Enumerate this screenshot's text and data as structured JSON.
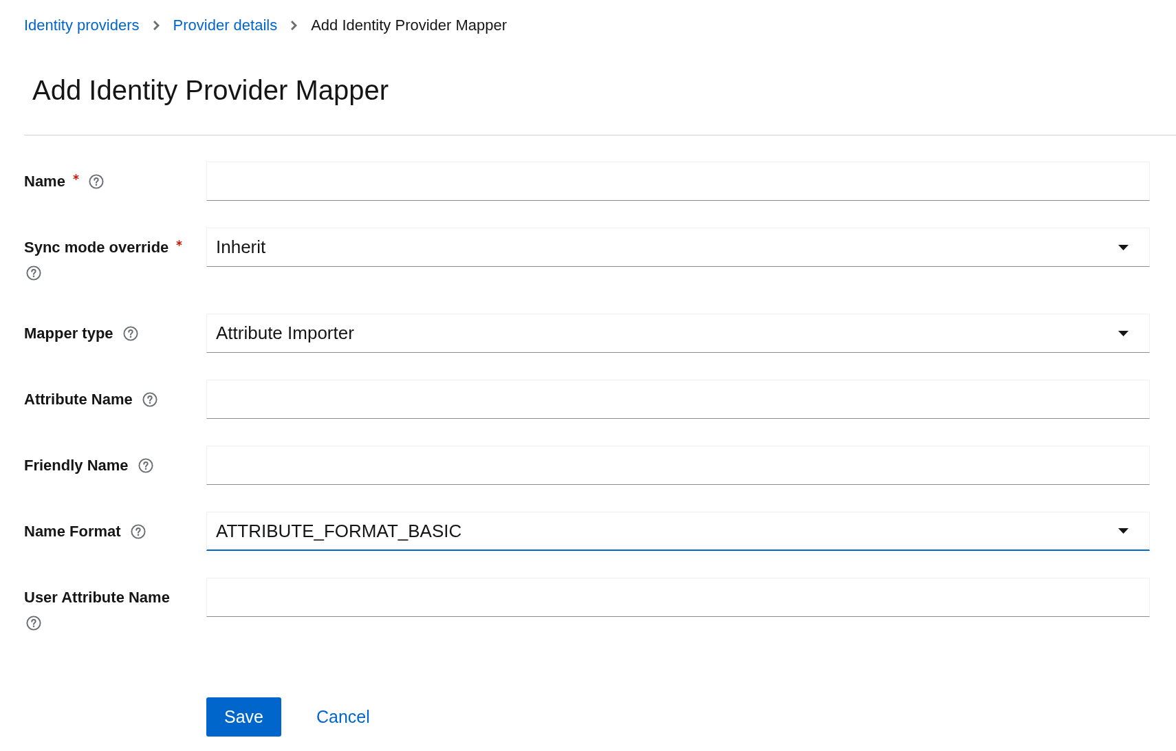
{
  "breadcrumb": [
    {
      "label": "Identity providers",
      "kind": "link"
    },
    {
      "label": "Provider details",
      "kind": "link"
    },
    {
      "label": "Add Identity Provider Mapper",
      "kind": "current"
    }
  ],
  "page": {
    "title": "Add Identity Provider Mapper"
  },
  "form": {
    "fields": [
      {
        "label": "Name",
        "required": true,
        "kind": "text",
        "focused": false
      },
      {
        "label": "Sync mode override",
        "required": true,
        "kind": "select",
        "value": "Inherit",
        "focused": false
      },
      {
        "label": "Mapper type",
        "required": false,
        "kind": "select",
        "value": "Attribute Importer",
        "focused": false
      },
      {
        "label": "Attribute Name",
        "required": false,
        "kind": "text",
        "focused": false
      },
      {
        "label": "Friendly Name",
        "required": false,
        "kind": "text",
        "focused": false
      },
      {
        "label": "Name Format",
        "required": false,
        "kind": "select",
        "value": "ATTRIBUTE_FORMAT_BASIC",
        "focused": true
      },
      {
        "label": "User Attribute Name",
        "required": false,
        "kind": "text",
        "focused": false
      }
    ]
  },
  "buttons": [
    {
      "label": "Save",
      "kind": "submit"
    },
    {
      "label": "Cancel",
      "kind": "cancel"
    }
  ]
}
